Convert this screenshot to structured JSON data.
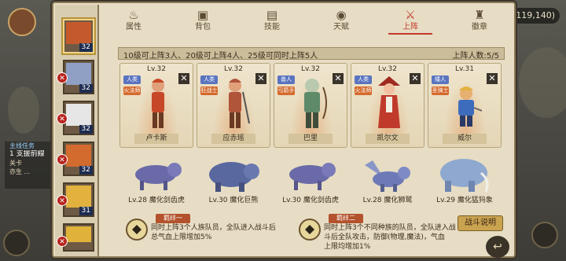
{
  "hud": {
    "coins": "119,140)",
    "quest": {
      "title": "主线任务",
      "line1": "1 支援前線",
      "line2": "关卡",
      "line3": "亦生 ..."
    }
  },
  "tabs": [
    {
      "label": "属性",
      "icon": "flame-icon"
    },
    {
      "label": "背包",
      "icon": "bag-icon"
    },
    {
      "label": "技能",
      "icon": "book-icon"
    },
    {
      "label": "天赋",
      "icon": "eye-icon"
    },
    {
      "label": "上阵",
      "icon": "swords-icon",
      "active": true
    },
    {
      "label": "徽章",
      "icon": "tower-icon"
    }
  ],
  "roster": [
    {
      "level": "32",
      "selected": true,
      "face": "#c45a2c"
    },
    {
      "level": "32",
      "face": "#8fa0c4"
    },
    {
      "level": "32",
      "face": "#e6e6e6"
    },
    {
      "level": "32",
      "face": "#d36a2e"
    },
    {
      "level": "31",
      "face": "#e2b13e"
    },
    {
      "level": "",
      "face": "#e0b23a"
    }
  ],
  "info_bar": {
    "rule": "10级可上阵3人、20级可上阵4人、25级可同时上阵5人",
    "count": "上阵人数:5/5"
  },
  "cards": [
    {
      "level": "Lv.32",
      "race": "人类",
      "job": "火法师",
      "name": "卢卡斯",
      "color": "#c74828"
    },
    {
      "level": "Lv.32",
      "race": "人类",
      "job": "狂战士",
      "name": "应赤瑶",
      "color": "#b0543a"
    },
    {
      "level": "Lv.32",
      "race": "兽人",
      "job": "弓箭手",
      "name": "巴里",
      "color": "#5f8a6a"
    },
    {
      "level": "Lv.32",
      "race": "人类",
      "job": "火法师",
      "name": "凯尔文",
      "color": "#c03a2c"
    },
    {
      "level": "Lv.31",
      "race": "矮人",
      "job": "圣骑士",
      "name": "威尔",
      "color": "#3e6cbc"
    }
  ],
  "mounts": [
    {
      "label": "Lv.28  魔化剑齿虎",
      "color": "#6a6aa8"
    },
    {
      "label": "Lv.30  魔化巨熊",
      "color": "#5a68a0"
    },
    {
      "label": "Lv.30  魔化剑齿虎",
      "color": "#6a6aa8"
    },
    {
      "label": "Lv.28  魔化狮鹫",
      "color": "#6e7ab8"
    },
    {
      "label": "Lv.29  魔化猛犸象",
      "color": "#8fa8d0"
    }
  ],
  "bonds": [
    {
      "title": "羁绊一",
      "desc": "同时上阵3个人族队员，全队进入战斗后\n总气血上限增加5%"
    },
    {
      "title": "羁绊二",
      "desc": "同时上阵3个不同种族的队员，全队进入战\n斗后全队攻击，防御(物理,魔法)，气血\n上限均增加1%"
    }
  ],
  "buttons": {
    "battle_info": "战斗说明"
  },
  "colors": {
    "accent": "#c23a2a",
    "panel": "#e7ddc4",
    "frame": "#8b7a58"
  }
}
